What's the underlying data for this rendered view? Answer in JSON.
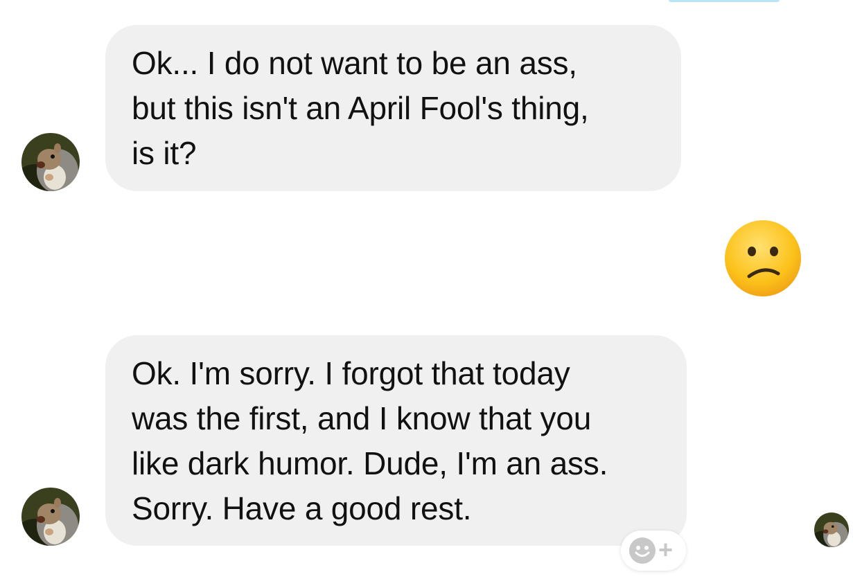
{
  "conversation": {
    "messages": [
      {
        "sender": "other",
        "text": "Ok... I do not want to be an ass,\nbut this isn't an April Fool's thing,\nis it?"
      },
      {
        "sender": "self",
        "emoji": "😕",
        "emoji_name": "confused-face"
      },
      {
        "sender": "other",
        "text": "Ok. I'm sorry. I forgot that today\nwas the first, and I know that you\nlike dark humor. Dude, I'm an ass.\nSorry. Have a good rest."
      }
    ],
    "reaction_button": {
      "icon": "smiley-face-icon",
      "plus": "+"
    },
    "read_receipt": {
      "icon": "squirrel-avatar"
    }
  },
  "colors": {
    "incoming_bubble": "#f0f0f0",
    "text": "#111111",
    "background": "#ffffff",
    "reaction_icon": "#c8c8c8",
    "top_accent": "#b8e6f7"
  }
}
